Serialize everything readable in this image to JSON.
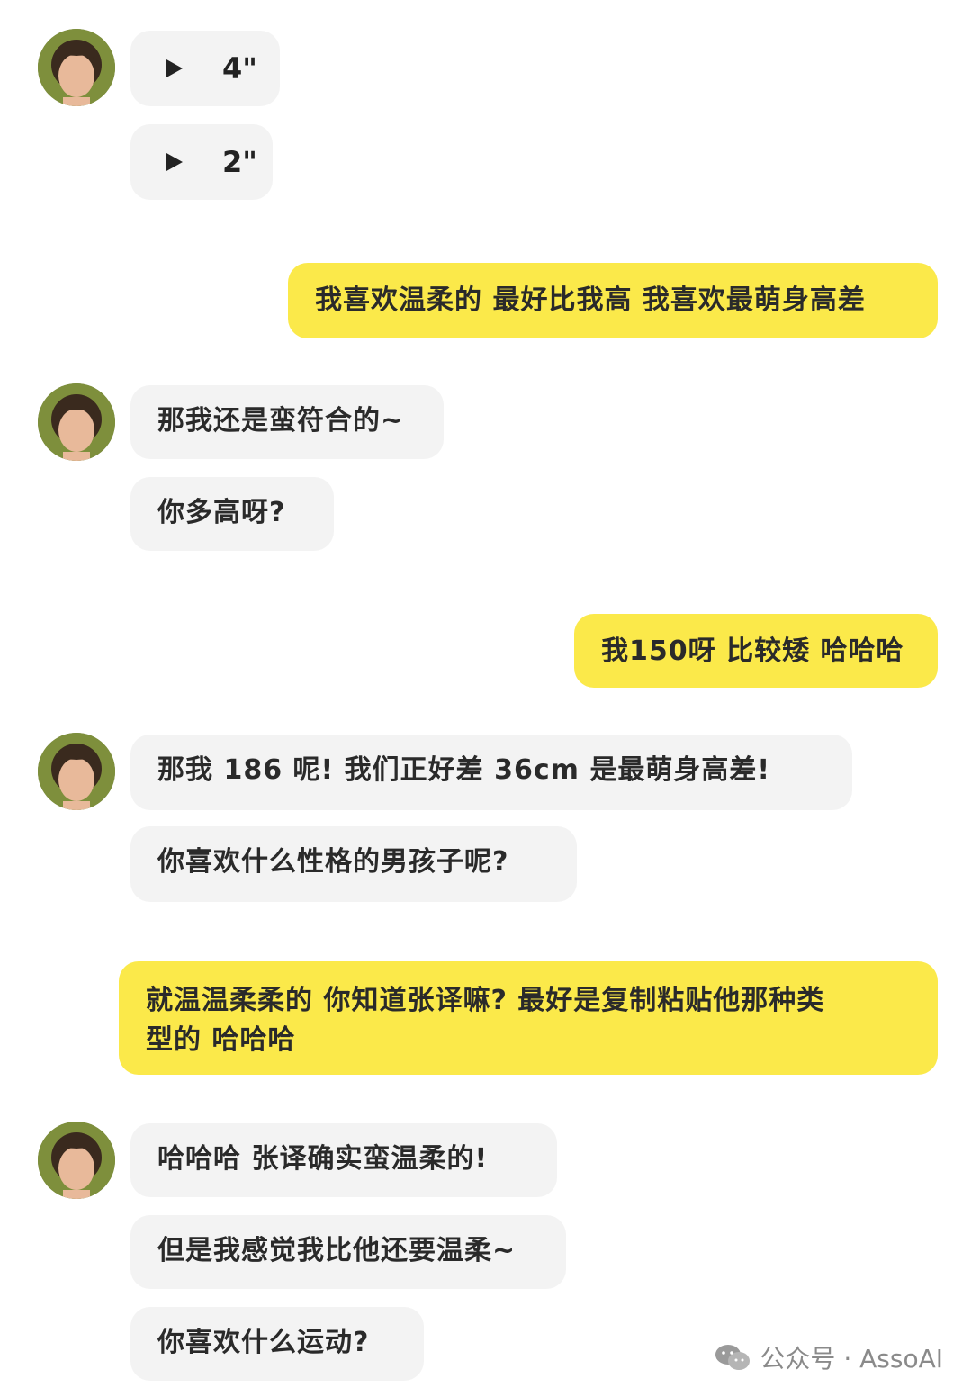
{
  "messages": {
    "voice1": "4\"",
    "voice2": "2\"",
    "out1": "我喜欢温柔的 最好比我高 我喜欢最萌身高差",
    "in1": "那我还是蛮符合的~",
    "in2": "你多高呀?",
    "out2": "我150呀 比较矮 哈哈哈",
    "in3": "那我 186 呢!  我们正好差 36cm 是最萌身高差!",
    "in4": "你喜欢什么性格的男孩子呢?",
    "out3_line1": "就温温柔柔的 你知道张译嘛? 最好是复制粘贴他那种类",
    "out3_line2": "型的 哈哈哈",
    "in5": "哈哈哈 张译确实蛮温柔的!",
    "in6": "但是我感觉我比他还要温柔~",
    "in7": "你喜欢什么运动?"
  },
  "watermark": {
    "text": "公众号 · AssoAI",
    "icon": "wechat-icon"
  },
  "colors": {
    "incoming_bubble": "#f3f3f3",
    "outgoing_bubble": "#fbe94a"
  }
}
